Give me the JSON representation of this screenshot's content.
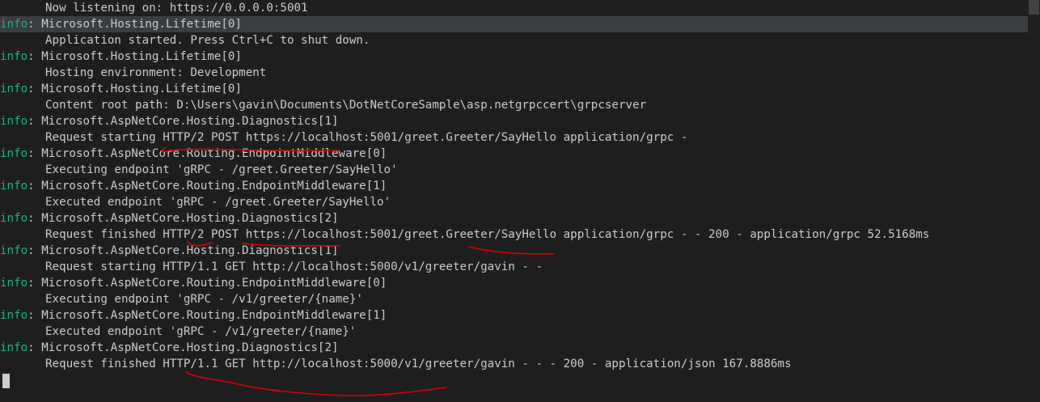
{
  "terminal": {
    "lines": [
      {
        "level": "",
        "text": "Now listening on: https://0.0.0.0:5001"
      },
      {
        "level": "info",
        "text": ": Microsoft.Hosting.Lifetime[0]"
      },
      {
        "level": "",
        "text": "Application started. Press Ctrl+C to shut down."
      },
      {
        "level": "info",
        "text": ": Microsoft.Hosting.Lifetime[0]"
      },
      {
        "level": "",
        "text": "Hosting environment: Development"
      },
      {
        "level": "info",
        "text": ": Microsoft.Hosting.Lifetime[0]"
      },
      {
        "level": "",
        "text": "Content root path: D:\\Users\\gavin\\Documents\\DotNetCoreSample\\asp.netgrpccert\\grpcserver"
      },
      {
        "level": "info",
        "text": ": Microsoft.AspNetCore.Hosting.Diagnostics[1]"
      },
      {
        "level": "",
        "text": "Request starting HTTP/2 POST https://localhost:5001/greet.Greeter/SayHello application/grpc -"
      },
      {
        "level": "info",
        "text": ": Microsoft.AspNetCore.Routing.EndpointMiddleware[0]"
      },
      {
        "level": "",
        "text": "Executing endpoint 'gRPC - /greet.Greeter/SayHello'"
      },
      {
        "level": "info",
        "text": ": Microsoft.AspNetCore.Routing.EndpointMiddleware[1]"
      },
      {
        "level": "",
        "text": "Executed endpoint 'gRPC - /greet.Greeter/SayHello'"
      },
      {
        "level": "info",
        "text": ": Microsoft.AspNetCore.Hosting.Diagnostics[2]"
      },
      {
        "level": "",
        "text": "Request finished HTTP/2 POST https://localhost:5001/greet.Greeter/SayHello application/grpc - - 200 - application/grpc 52.5168ms"
      },
      {
        "level": "info",
        "text": ": Microsoft.AspNetCore.Hosting.Diagnostics[1]"
      },
      {
        "level": "",
        "text": "Request starting HTTP/1.1 GET http://localhost:5000/v1/greeter/gavin - -"
      },
      {
        "level": "info",
        "text": ": Microsoft.AspNetCore.Routing.EndpointMiddleware[0]"
      },
      {
        "level": "",
        "text": "Executing endpoint 'gRPC - /v1/greeter/{name}'"
      },
      {
        "level": "info",
        "text": ": Microsoft.AspNetCore.Routing.EndpointMiddleware[1]"
      },
      {
        "level": "",
        "text": "Executed endpoint 'gRPC - /v1/greeter/{name}'"
      },
      {
        "level": "info",
        "text": ": Microsoft.AspNetCore.Hosting.Diagnostics[2]"
      },
      {
        "level": "",
        "text": "Request finished HTTP/1.1 GET http://localhost:5000/v1/greeter/gavin - - - 200 - application/json 167.8886ms"
      }
    ]
  },
  "colors": {
    "background": "#1e1e1e",
    "text": "#cccccc",
    "info_level": "#0dbc79",
    "annotation": "#e00000"
  }
}
